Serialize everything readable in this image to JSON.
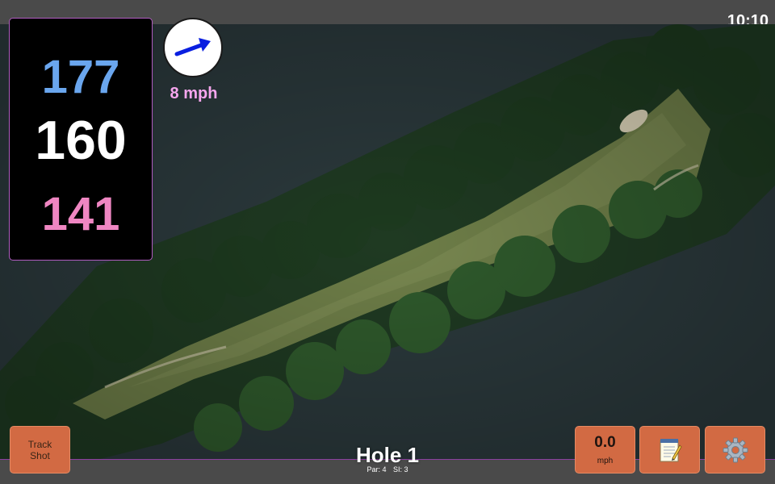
{
  "status": {
    "clock": "10:10"
  },
  "distances": {
    "back": "177",
    "middle": "160",
    "front": "141"
  },
  "wind": {
    "speed": "8 mph",
    "direction_icon": "wind-arrow-icon",
    "arrow_color": "#0a1fe0"
  },
  "hole": {
    "title": "Hole 1",
    "par": "Par: 4",
    "stroke_index": "SI: 3"
  },
  "buttons": {
    "track_shot_line1": "Track",
    "track_shot_line2": "Shot",
    "speed_value": "0.0",
    "speed_unit": "mph",
    "notes_icon": "notepad-icon",
    "settings_icon": "gear-icon"
  },
  "colors": {
    "back_distance": "#6aa6ee",
    "middle_distance": "#ffffff",
    "front_distance": "#ef86c2",
    "wind_text": "#f6a6ee",
    "button": "#d26a43",
    "accent_border": "#8c3fa0"
  }
}
